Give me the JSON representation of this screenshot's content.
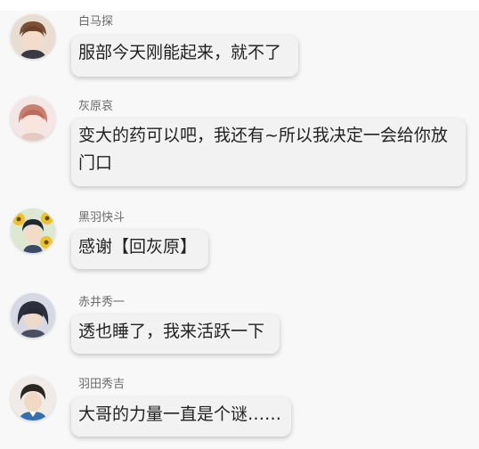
{
  "messages": [
    {
      "sender": "白马探",
      "text": "服部今天刚能起来，就不了"
    },
    {
      "sender": "灰原哀",
      "text": "变大的药可以吧，我还有~所以我决定一会给你放门口"
    },
    {
      "sender": "黑羽快斗",
      "text": "感谢【回灰原】"
    },
    {
      "sender": "赤井秀一",
      "text": "透也睡了，我来活跃一下"
    },
    {
      "sender": "羽田秀吉",
      "text": "大哥的力量一直是个谜……"
    }
  ]
}
